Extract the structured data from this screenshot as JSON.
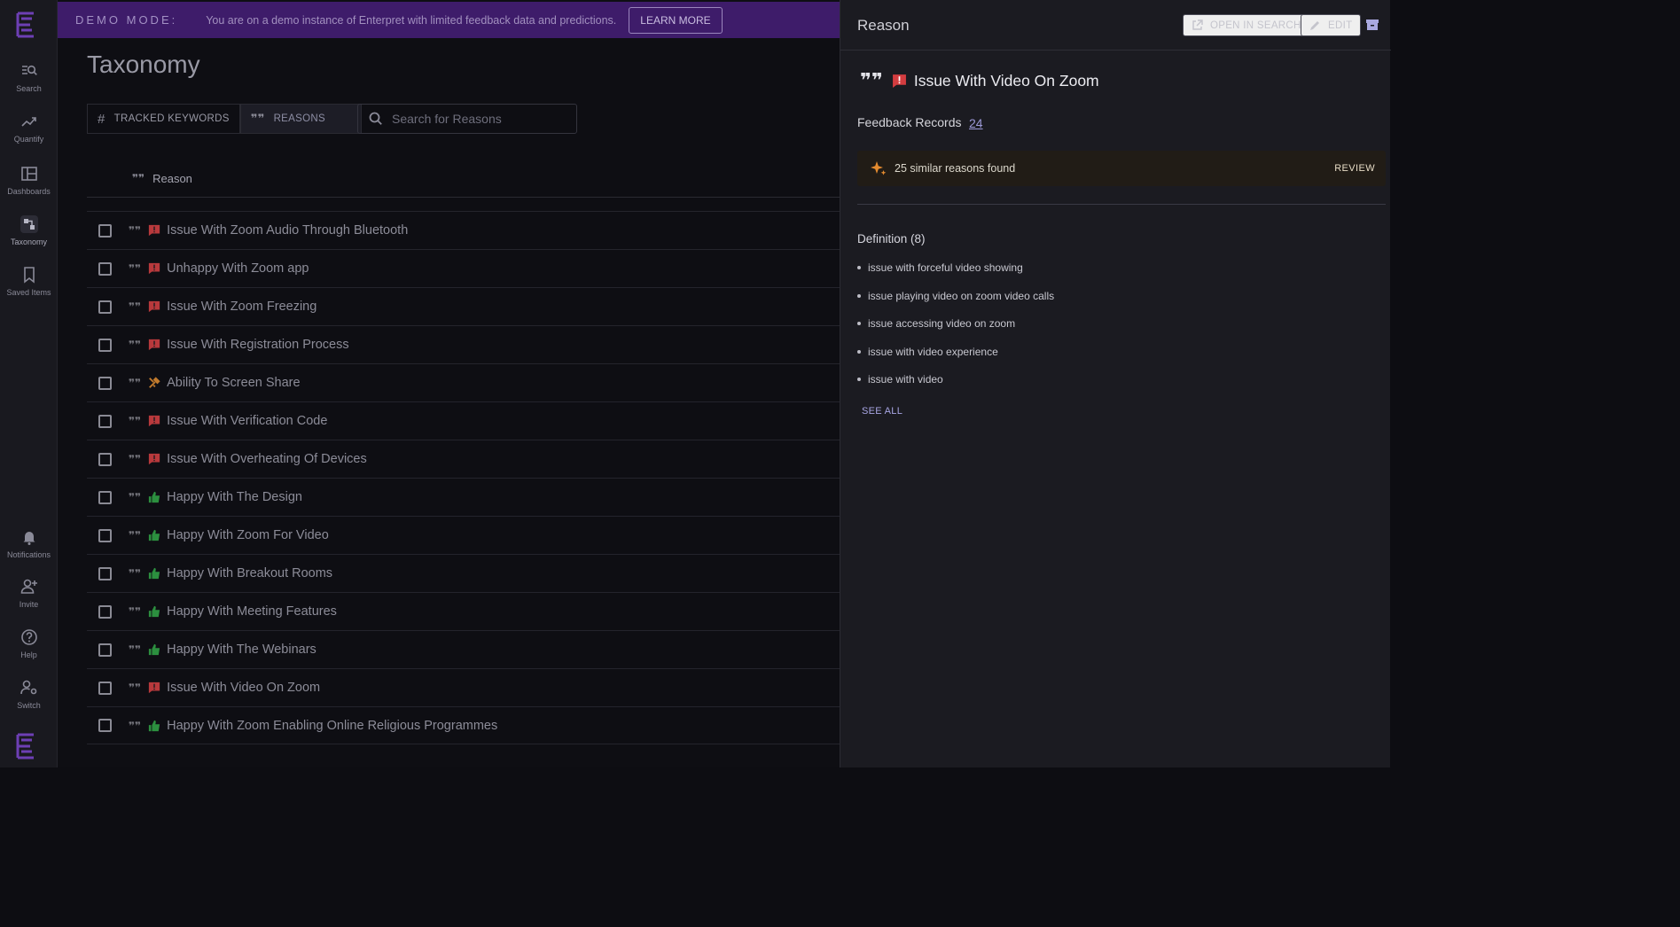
{
  "rail": {
    "items": [
      {
        "label": "Search",
        "icon": "search-list-icon"
      },
      {
        "label": "Quantify",
        "icon": "trend-icon"
      },
      {
        "label": "Dashboards",
        "icon": "dashboard-icon"
      },
      {
        "label": "Taxonomy",
        "icon": "taxonomy-icon",
        "active": true
      },
      {
        "label": "Saved Items",
        "icon": "bookmark-icon"
      }
    ],
    "bottom_items": [
      {
        "label": "Notifications",
        "icon": "bell-icon"
      },
      {
        "label": "Invite",
        "icon": "add-user-icon"
      },
      {
        "label": "Help",
        "icon": "help-icon"
      },
      {
        "label": "Switch",
        "icon": "switch-user-icon"
      }
    ]
  },
  "banner": {
    "mode": "DEMO MODE:",
    "text": "You are on a demo instance of Enterpret with limited feedback data and predictions.",
    "button": "LEARN MORE"
  },
  "page": {
    "title": "Taxonomy",
    "tabs": [
      "TRACKED KEYWORDS",
      "REASONS"
    ],
    "search_placeholder": "Search for Reasons",
    "column_header": "Reason"
  },
  "rows": [
    {
      "label": "Issue With Zoom Audio Through Bluetooth",
      "type": "issue"
    },
    {
      "label": "Unhappy With Zoom app",
      "type": "issue"
    },
    {
      "label": "Issue With Zoom Freezing",
      "type": "issue"
    },
    {
      "label": "Issue With Registration Process",
      "type": "issue"
    },
    {
      "label": "Ability To Screen Share",
      "type": "request"
    },
    {
      "label": "Issue With Verification Code",
      "type": "issue"
    },
    {
      "label": "Issue With Overheating Of Devices",
      "type": "issue"
    },
    {
      "label": "Happy With The Design",
      "type": "praise"
    },
    {
      "label": "Happy With Zoom For Video",
      "type": "praise"
    },
    {
      "label": "Happy With Breakout Rooms",
      "type": "praise"
    },
    {
      "label": "Happy With Meeting Features",
      "type": "praise"
    },
    {
      "label": "Happy With The Webinars",
      "type": "praise"
    },
    {
      "label": "Issue With Video On Zoom",
      "type": "issue"
    },
    {
      "label": "Happy With Zoom Enabling Online Religious Programmes",
      "type": "praise"
    }
  ],
  "panel": {
    "title": "Reason",
    "open_in_search": "OPEN IN SEARCH",
    "edit": "EDIT",
    "reason_title": "Issue With Video On Zoom",
    "feedback_label": "Feedback Records",
    "feedback_count": "24",
    "similar_text": "25 similar reasons found",
    "review": "REVIEW",
    "definition_title": "Definition (8)",
    "definitions": [
      "issue with forceful video showing",
      "issue playing video on zoom video calls",
      "issue accessing video on zoom",
      "issue with video experience",
      "issue with video"
    ],
    "see_all": "SEE ALL"
  },
  "colors": {
    "brand": "#5b2f91",
    "issue": "#c8373a",
    "praise": "#2f9e44",
    "request": "#c9822f",
    "link": "#9d9ad8"
  }
}
